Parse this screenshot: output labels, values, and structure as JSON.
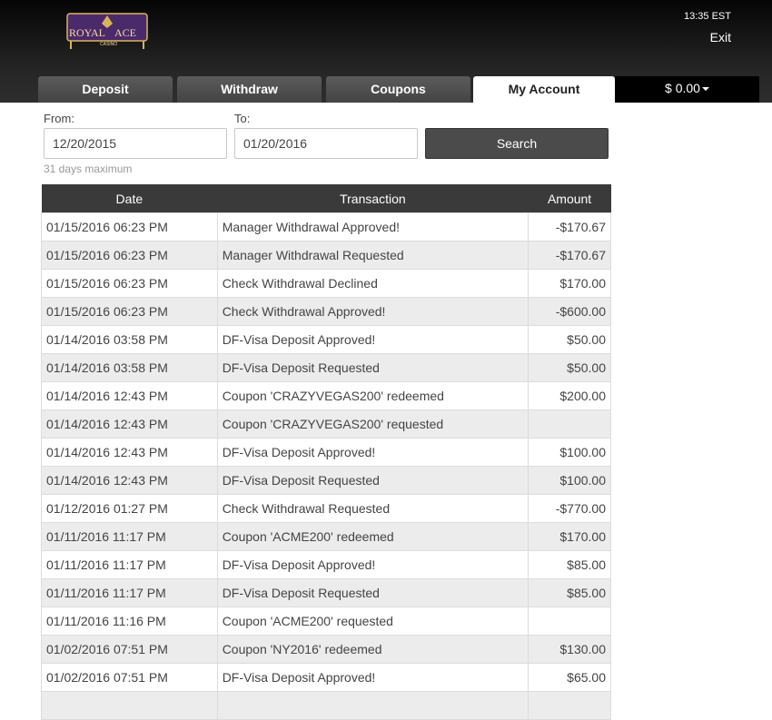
{
  "header": {
    "logo_text_1": "ROYAL",
    "logo_text_2": "ACE",
    "logo_text_3": "CASINO",
    "time": "13:35 EST",
    "exit_label": "Exit"
  },
  "tabs": [
    {
      "label": "Deposit"
    },
    {
      "label": "Withdraw"
    },
    {
      "label": "Coupons"
    },
    {
      "label": "My Account",
      "active": true
    }
  ],
  "balance": "$ 0.00",
  "filters": {
    "from_label": "From:",
    "from_value": "12/20/2015",
    "to_label": "To:",
    "to_value": "01/20/2016",
    "search_label": "Search",
    "hint": "31 days maximum"
  },
  "table": {
    "headers": [
      "Date",
      "Transaction",
      "Amount"
    ],
    "rows": [
      {
        "date": "01/15/2016 06:23 PM",
        "transaction": "Manager Withdrawal Approved!",
        "amount": "-$170.67"
      },
      {
        "date": "01/15/2016 06:23 PM",
        "transaction": "Manager Withdrawal Requested",
        "amount": "-$170.67"
      },
      {
        "date": "01/15/2016 06:23 PM",
        "transaction": "Check Withdrawal Declined",
        "amount": "$170.00"
      },
      {
        "date": "01/15/2016 06:23 PM",
        "transaction": "Check Withdrawal Approved!",
        "amount": "-$600.00"
      },
      {
        "date": "01/14/2016 03:58 PM",
        "transaction": "DF-Visa Deposit Approved!",
        "amount": "$50.00"
      },
      {
        "date": "01/14/2016 03:58 PM",
        "transaction": "DF-Visa Deposit Requested",
        "amount": "$50.00"
      },
      {
        "date": "01/14/2016 12:43 PM",
        "transaction": "Coupon 'CRAZYVEGAS200' redeemed",
        "amount": "$200.00"
      },
      {
        "date": "01/14/2016 12:43 PM",
        "transaction": "Coupon 'CRAZYVEGAS200' requested",
        "amount": ""
      },
      {
        "date": "01/14/2016 12:43 PM",
        "transaction": "DF-Visa Deposit Approved!",
        "amount": "$100.00"
      },
      {
        "date": "01/14/2016 12:43 PM",
        "transaction": "DF-Visa Deposit Requested",
        "amount": "$100.00"
      },
      {
        "date": "01/12/2016 01:27 PM",
        "transaction": "Check Withdrawal Requested",
        "amount": "-$770.00"
      },
      {
        "date": "01/11/2016 11:17 PM",
        "transaction": "Coupon 'ACME200' redeemed",
        "amount": "$170.00"
      },
      {
        "date": "01/11/2016 11:17 PM",
        "transaction": "DF-Visa Deposit Approved!",
        "amount": "$85.00"
      },
      {
        "date": "01/11/2016 11:17 PM",
        "transaction": "DF-Visa Deposit Requested",
        "amount": "$85.00"
      },
      {
        "date": "01/11/2016 11:16 PM",
        "transaction": "Coupon 'ACME200' requested",
        "amount": ""
      },
      {
        "date": "01/02/2016 07:51 PM",
        "transaction": "Coupon 'NY2016' redeemed",
        "amount": "$130.00"
      },
      {
        "date": "01/02/2016 07:51 PM",
        "transaction": "DF-Visa Deposit Approved!",
        "amount": "$65.00"
      },
      {
        "date": "",
        "transaction": "",
        "amount": ""
      }
    ]
  },
  "colors": {
    "header_bg": "#2a2a2a",
    "tab_bg": "#4f4f4f",
    "table_header_bg": "#3a3a3a",
    "row_alt_bg": "#ececec",
    "logo_purple": "#4b2a6b",
    "logo_gold": "#d9b45a"
  }
}
